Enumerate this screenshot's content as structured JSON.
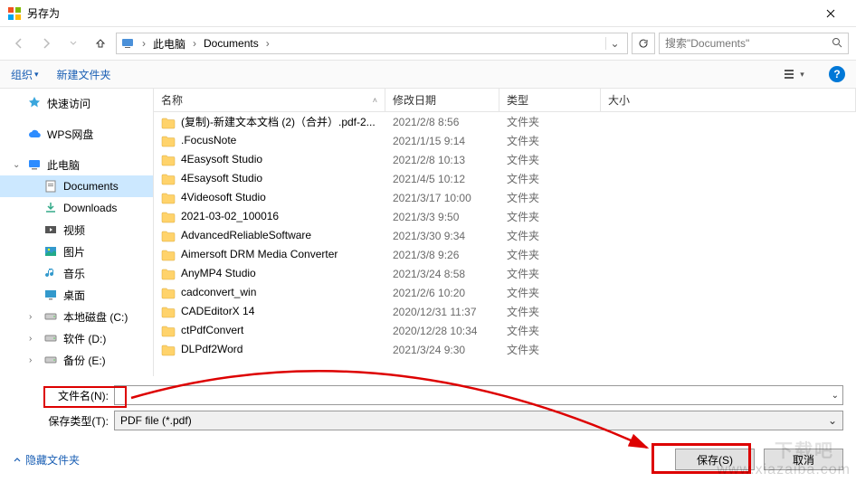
{
  "window": {
    "title": "另存为"
  },
  "breadcrumb": {
    "root": "此电脑",
    "folder": "Documents"
  },
  "search": {
    "placeholder": "搜索\"Documents\""
  },
  "toolbar": {
    "organize": "组织",
    "new_folder": "新建文件夹"
  },
  "columns": {
    "name": "名称",
    "date": "修改日期",
    "type": "类型",
    "size": "大小"
  },
  "sidebar": {
    "items": [
      {
        "label": "快速访问",
        "icon": "star",
        "color": "#3aa6dd"
      },
      {
        "label": "WPS网盘",
        "icon": "cloud",
        "color": "#2d8cff"
      },
      {
        "label": "此电脑",
        "icon": "pc",
        "color": "#2d8cff",
        "expanded": true
      },
      {
        "label": "Documents",
        "icon": "doc",
        "indent": true,
        "selected": true
      },
      {
        "label": "Downloads",
        "icon": "dl",
        "indent": true
      },
      {
        "label": "视频",
        "icon": "video",
        "indent": true
      },
      {
        "label": "图片",
        "icon": "pic",
        "indent": true
      },
      {
        "label": "音乐",
        "icon": "music",
        "indent": true
      },
      {
        "label": "桌面",
        "icon": "desktop",
        "indent": true
      },
      {
        "label": "本地磁盘 (C:)",
        "icon": "disk",
        "indent": true,
        "expandable": true
      },
      {
        "label": "软件 (D:)",
        "icon": "disk",
        "indent": true,
        "expandable": true
      },
      {
        "label": "备份 (E:)",
        "icon": "disk",
        "indent": true,
        "expandable": true
      }
    ]
  },
  "files": [
    {
      "name": "(复制)-新建文本文档 (2)（合并）.pdf-2...",
      "date": "2021/2/8 8:56",
      "type": "文件夹"
    },
    {
      "name": ".FocusNote",
      "date": "2021/1/15 9:14",
      "type": "文件夹"
    },
    {
      "name": "4Easysoft Studio",
      "date": "2021/2/8 10:13",
      "type": "文件夹"
    },
    {
      "name": "4Esaysoft Studio",
      "date": "2021/4/5 10:12",
      "type": "文件夹"
    },
    {
      "name": "4Videosoft Studio",
      "date": "2021/3/17 10:00",
      "type": "文件夹"
    },
    {
      "name": "2021-03-02_100016",
      "date": "2021/3/3 9:50",
      "type": "文件夹"
    },
    {
      "name": "AdvancedReliableSoftware",
      "date": "2021/3/30 9:34",
      "type": "文件夹"
    },
    {
      "name": "Aimersoft DRM Media Converter",
      "date": "2021/3/8 9:26",
      "type": "文件夹"
    },
    {
      "name": "AnyMP4 Studio",
      "date": "2021/3/24 8:58",
      "type": "文件夹"
    },
    {
      "name": "cadconvert_win",
      "date": "2021/2/6 10:20",
      "type": "文件夹"
    },
    {
      "name": "CADEditorX 14",
      "date": "2020/12/31 11:37",
      "type": "文件夹"
    },
    {
      "name": "ctPdfConvert",
      "date": "2020/12/28 10:34",
      "type": "文件夹"
    },
    {
      "name": "DLPdf2Word",
      "date": "2021/3/24 9:30",
      "type": "文件夹"
    }
  ],
  "filename": {
    "label": "文件名(N):",
    "value": ""
  },
  "filetype": {
    "label": "保存类型(T):",
    "value": "PDF file (*.pdf)"
  },
  "footer": {
    "hide": "隐藏文件夹",
    "save": "保存(S)",
    "cancel": "取消"
  },
  "watermark": {
    "line1": "下载吧",
    "line2": "www.xiazaiba.com"
  }
}
